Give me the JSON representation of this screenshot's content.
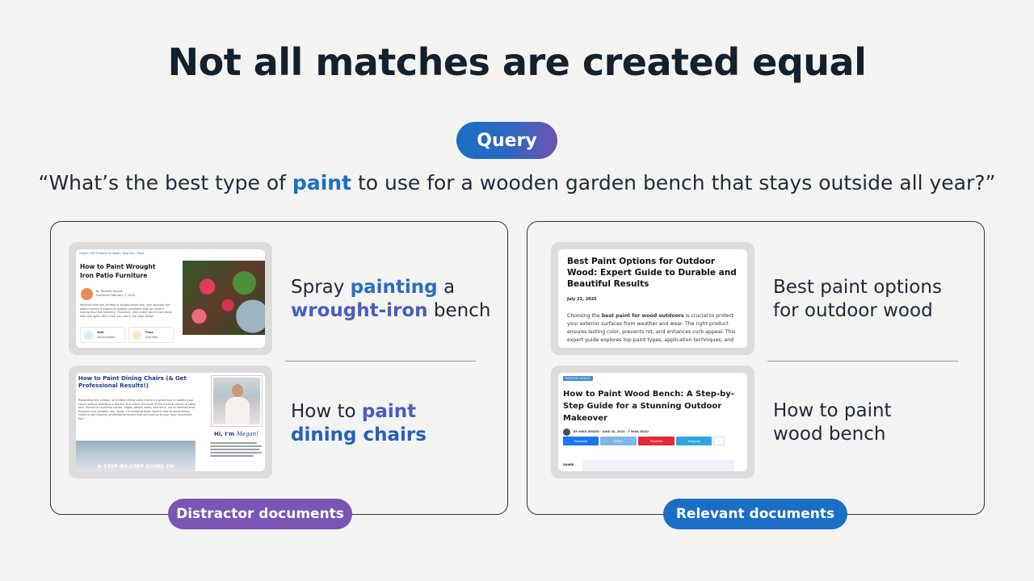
{
  "slide": {
    "title": "Not all matches are created equal",
    "query_badge": "Query",
    "query_parts": {
      "open": "“What’s the best type of ",
      "keyword": "paint",
      "rest": " to use for a wooden garden bench that stays outside all year?”"
    }
  },
  "distractor": {
    "badge": "Distractor documents",
    "items": [
      {
        "label_parts": [
          "Spray ",
          "painting",
          " a",
          "wrought-iron",
          " bench"
        ],
        "thumb": {
          "breadcrumb": "Home / DIY Projects & Ideas / How-Tos / Paint",
          "title": "How to Paint Wrought Iron Patio Furniture",
          "byline": "By Rachael Pannet",
          "published": "Published February 3, 2024",
          "intro": "Whether inherited, thrifted or bought brand new, your wrought iron patio furniture is subject to outdoor conditions that can leave it looking less than beautiful. Thankfully, with a little paint it can easily look new again. We'll show you how in the steps below.",
          "skill_label": "Skill",
          "skill_value": "Intermediate",
          "time_label": "Time",
          "time_value": "One Day"
        }
      },
      {
        "label_parts": [
          "How to ",
          "paint",
          "dining chairs"
        ],
        "thumb": {
          "title": "How to Paint Dining Chairs (& Get Professional Results!)",
          "intro": "Repainting old, vintage, or thrifted dining room chairs is a great way to update your space without spending a fortune. But chairs are some of the trickiest pieces to paint well, thanks to countless curves, edges, bends, seats, and arms, not to mention their frequent and constant use. Today, I'm breaking down exactly how to paint dining chairs to get flawless, professional results that will hold up to your busy household too!",
          "greeting_prefix": "Hi, I'm ",
          "greeting_name": "Megan!",
          "room_caption": "A STEP-BY-STEP GUIDE TO"
        }
      }
    ]
  },
  "relevant": {
    "badge": "Relevant documents",
    "items": [
      {
        "label_line1": "Best paint options",
        "label_line2": "for outdoor wood",
        "thumb": {
          "title": "Best Paint Options for Outdoor Wood: Expert Guide to Durable and Beautiful Results",
          "date": "July 22, 2025",
          "intro_prefix": "Choosing the ",
          "intro_bold": "best paint for wood outdoors",
          "intro_rest": " is crucial to protect your exterior surfaces from weather and wear. The right product ensures lasting color, prevents rot, and enhances curb appeal. This expert guide explores top paint types, application techniques, and essential tips to keep your wood projects"
        }
      },
      {
        "label_line1": "How to paint",
        "label_line2": "wood bench",
        "thumb": {
          "tag": "PAINTING ADVICE",
          "title": "How to Paint Wood Bench: A Step-by-Step Guide for a Stunning Outdoor Makeover",
          "meta": "BY MIKE JENSEN · JUNE 30, 2023 · 7 MINS READ",
          "social": [
            "Facebook",
            "Twitter",
            "Pinterest",
            "Telegram"
          ],
          "share": "SHARE"
        }
      }
    ]
  },
  "colors": {
    "blue": "#1a6fc4",
    "purple": "#7b55b3",
    "title": "#13212e"
  }
}
